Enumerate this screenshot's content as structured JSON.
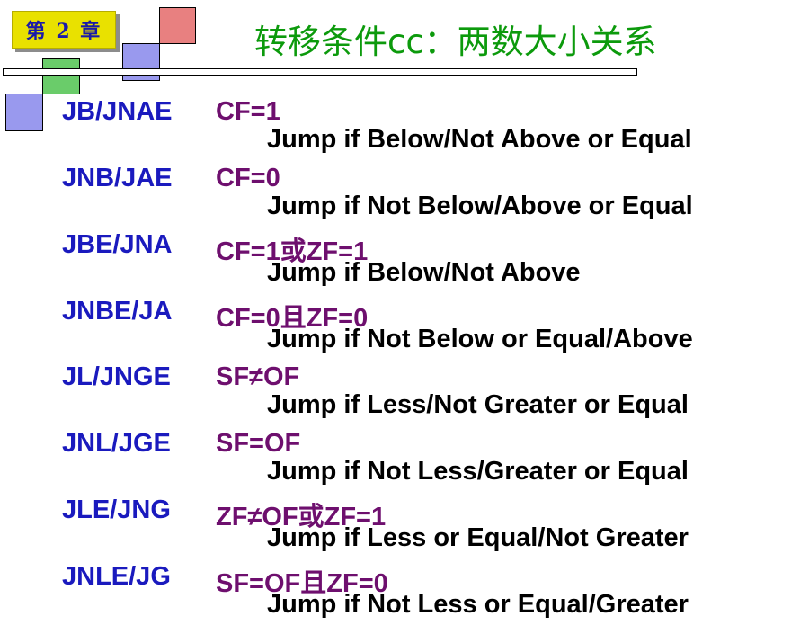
{
  "header": {
    "chapter_label": "第 2 章",
    "title": "转移条件cc：两数大小关系"
  },
  "entries": [
    {
      "mnemonic": "JB/JNAE",
      "condition": "CF=1",
      "description": "Jump if Below/Not Above or Equal"
    },
    {
      "mnemonic": "JNB/JAE",
      "condition": "CF=0",
      "description": "Jump if Not Below/Above or Equal"
    },
    {
      "mnemonic": "JBE/JNA",
      "condition": "CF=1或ZF=1",
      "description": "Jump if Below/Not Above"
    },
    {
      "mnemonic": "JNBE/JA",
      "condition": "CF=0且ZF=0",
      "description": "Jump if Not Below or Equal/Above"
    },
    {
      "mnemonic": "JL/JNGE",
      "condition": "SF≠OF",
      "description": "Jump if Less/Not Greater or Equal"
    },
    {
      "mnemonic": "JNL/JGE",
      "condition": "SF=OF",
      "description": "Jump if Not Less/Greater or Equal"
    },
    {
      "mnemonic": "JLE/JNG",
      "condition": "ZF≠OF或ZF=1",
      "description": "Jump if Less or Equal/Not Greater"
    },
    {
      "mnemonic": "JNLE/JG",
      "condition": "SF=OF且ZF=0",
      "description": "Jump if Not Less or Equal/Greater"
    }
  ],
  "colors": {
    "title": "#0c9a0c",
    "mnemonic": "#1a1abe",
    "condition": "#6e0f6e",
    "description": "#000000",
    "badge": "#e9e100"
  }
}
